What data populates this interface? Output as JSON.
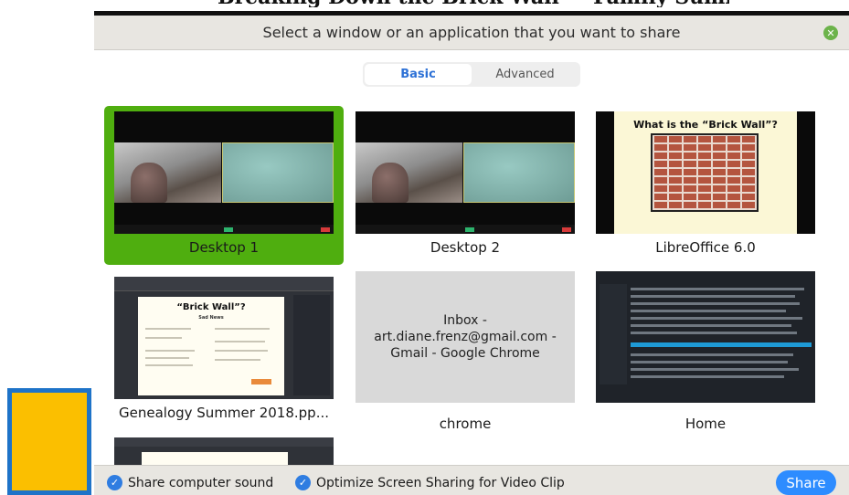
{
  "background": {
    "heading": "Breaking Down the Brick Wall — Family Summary"
  },
  "dialog": {
    "title": "Select a window or an application that you want to share",
    "close_icon": "close-icon",
    "tabs": [
      {
        "label": "Basic",
        "active": true
      },
      {
        "label": "Advanced",
        "active": false
      }
    ],
    "tiles": [
      {
        "label": "Desktop 1",
        "selected": true
      },
      {
        "label": "Desktop 2",
        "selected": false
      },
      {
        "label": "LibreOffice 6.0",
        "selected": false
      },
      {
        "label": "Genealogy Summer 2018.pp...",
        "selected": false
      },
      {
        "label": "chrome",
        "selected": false,
        "preview_text": "Inbox - art.diane.frenz@gmail.com - Gmail - Google Chrome"
      },
      {
        "label": "Home",
        "selected": false
      }
    ],
    "previews": {
      "libreoffice_title": "What is the “Brick Wall”?",
      "genealogy_title": "“Brick Wall”?",
      "genealogy_subtitle": "Sad News"
    },
    "footer": {
      "share_sound_label": "Share computer sound",
      "share_sound_checked": true,
      "optimize_label": "Optimize Screen Sharing for Video Clip",
      "optimize_checked": true,
      "share_button": "Share"
    }
  },
  "colors": {
    "selected_tile": "#4fae0f",
    "accent_blue": "#2d8cff",
    "tab_active_text": "#2d71d6"
  }
}
